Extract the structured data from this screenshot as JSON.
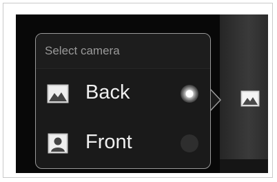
{
  "popup": {
    "title": "Select camera",
    "options": [
      {
        "label": "Back",
        "icon": "landscape-photo-icon",
        "selected": true
      },
      {
        "label": "Front",
        "icon": "portrait-photo-icon",
        "selected": false
      }
    ]
  },
  "side_panel": {
    "mode_icon": "landscape-photo-icon"
  },
  "colors": {
    "screen_bg": "#080808",
    "popup_border": "#9a9a9a",
    "text": "#f0f0f0",
    "title_text": "#9a9a9a"
  }
}
